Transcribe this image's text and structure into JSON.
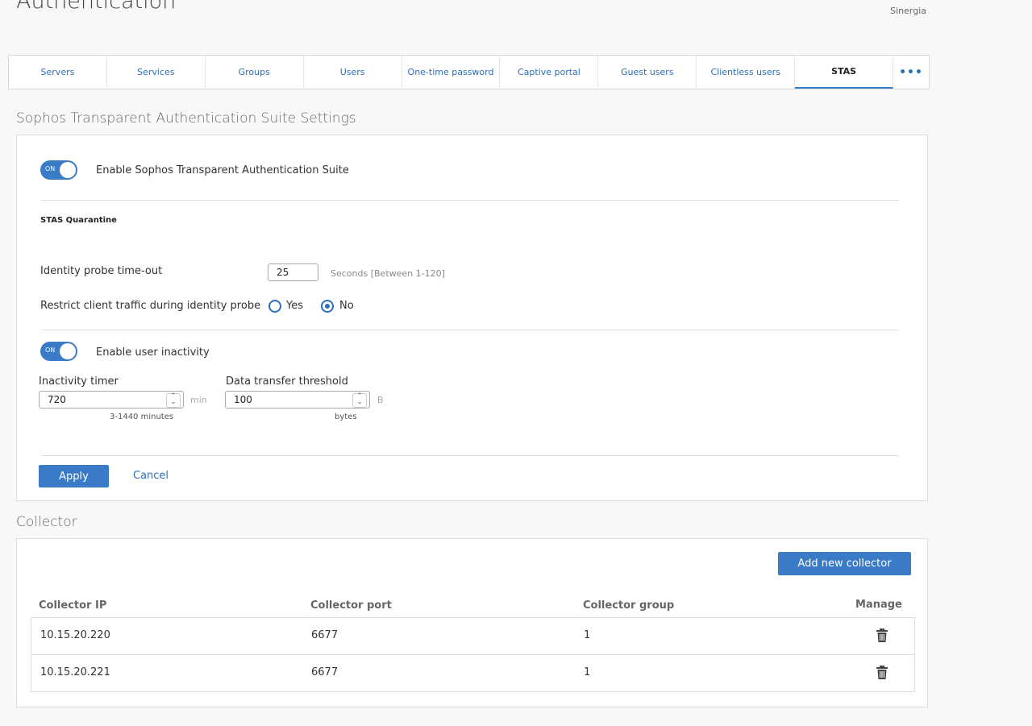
{
  "header": {
    "page_title": "Authentication",
    "tenant": "Sinergia"
  },
  "tabs": [
    {
      "label": "Servers",
      "active": false
    },
    {
      "label": "Services",
      "active": false
    },
    {
      "label": "Groups",
      "active": false
    },
    {
      "label": "Users",
      "active": false
    },
    {
      "label": "One-time password",
      "active": false
    },
    {
      "label": "Captive portal",
      "active": false
    },
    {
      "label": "Guest users",
      "active": false
    },
    {
      "label": "Clientless users",
      "active": false
    },
    {
      "label": "STAS",
      "active": true
    }
  ],
  "tabs_more_label": "•••",
  "stas_settings": {
    "title": "Sophos Transparent Authentication Suite Settings",
    "enable_toggle_state": "ON",
    "enable_label": "Enable Sophos Transparent Authentication Suite",
    "quarantine_heading": "STAS Quarantine",
    "probe_timeout_label": "Identity probe time-out",
    "probe_timeout_value": "25",
    "probe_timeout_hint": "Seconds [Between 1-120]",
    "restrict_label": "Restrict client traffic during identity probe",
    "restrict_options": [
      {
        "label": "Yes",
        "checked": false
      },
      {
        "label": "No",
        "checked": true
      }
    ],
    "inactivity_toggle_state": "ON",
    "inactivity_label": "Enable user inactivity",
    "inactivity_timer_label": "Inactivity timer",
    "inactivity_timer_value": "720",
    "inactivity_timer_unit": "min",
    "inactivity_timer_hint": "3-1440 minutes",
    "threshold_label": "Data transfer threshold",
    "threshold_value": "100",
    "threshold_unit": "B",
    "threshold_hint": "bytes",
    "apply_label": "Apply",
    "cancel_label": "Cancel"
  },
  "collector": {
    "title": "Collector",
    "add_button_label": "Add new collector",
    "columns": [
      "Collector IP",
      "Collector port",
      "Collector group",
      "Manage"
    ],
    "rows": [
      {
        "ip": "10.15.20.220",
        "port": "6677",
        "group": "1"
      },
      {
        "ip": "10.15.20.221",
        "port": "6677",
        "group": "1"
      }
    ]
  },
  "colors": {
    "accent": "#3a7bc8",
    "link": "#2a6fbd",
    "border": "#dcdcdc"
  },
  "icons": {
    "delete": "trash-icon",
    "spinner": "updown-arrows-icon"
  }
}
